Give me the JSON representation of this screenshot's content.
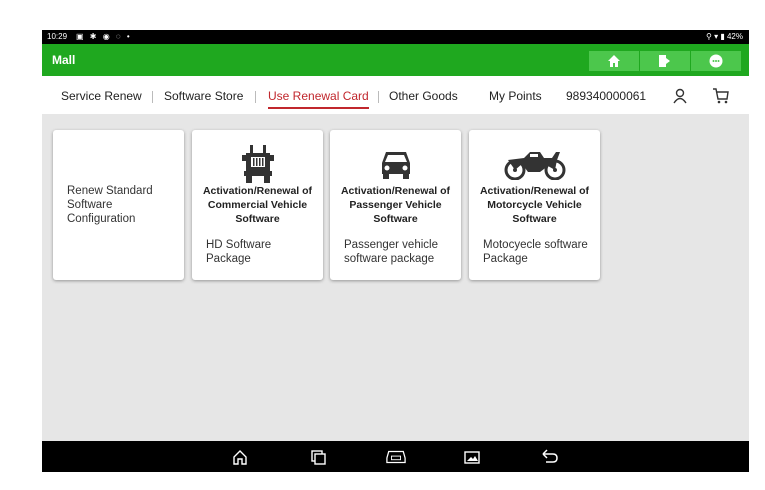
{
  "status_bar": {
    "time": "10:29",
    "left_icons": [
      "notification-icon",
      "gear-icon",
      "app-icon",
      "chat-icon",
      "dot-icon"
    ],
    "battery": "42%",
    "right_icons": [
      "location-icon",
      "wifi-icon",
      "battery-icon"
    ]
  },
  "app_bar": {
    "title": "Mall",
    "buttons": [
      "home-icon",
      "exit-icon",
      "message-icon"
    ],
    "color": "#1fa81f"
  },
  "tabs": {
    "items": [
      {
        "label": "Service Renew"
      },
      {
        "label": "Software Store"
      },
      {
        "label": "Use Renewal Card"
      },
      {
        "label": "Other Goods"
      }
    ],
    "active_index": 2,
    "accent": "#c1272d",
    "my_points_label": "My Points",
    "points_value": "989340000061"
  },
  "cards": [
    {
      "text": "Renew Standard Software Configuration"
    },
    {
      "icon": "truck-icon",
      "title": "Activation/Renewal of Commercial Vehicle Software",
      "description": "HD Software Package"
    },
    {
      "icon": "car-icon",
      "title": "Activation/Renewal of Passenger Vehicle Software",
      "description": "Passenger vehicle software package"
    },
    {
      "icon": "motorcycle-icon",
      "title": "Activation/Renewal of Motorcycle Vehicle Software",
      "description": "Motocyecle software Package"
    }
  ],
  "nav_bar": {
    "icons": [
      "home-nav-icon",
      "recents-icon",
      "vci-icon",
      "screenshot-icon",
      "back-icon"
    ]
  }
}
